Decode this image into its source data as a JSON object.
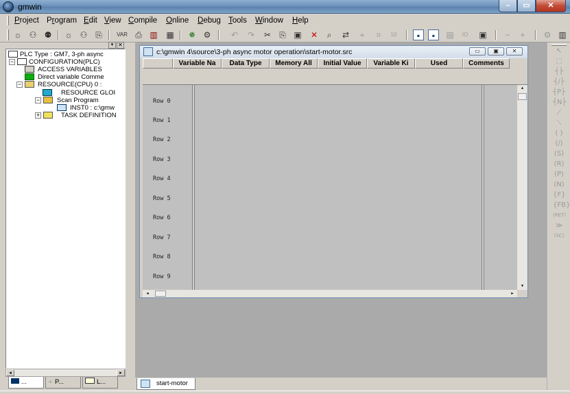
{
  "window": {
    "title": "gmwin"
  },
  "menu": {
    "items": [
      {
        "label": "Project",
        "key": "P"
      },
      {
        "label": "Program",
        "key": "r"
      },
      {
        "label": "Edit",
        "key": "E"
      },
      {
        "label": "View",
        "key": "V"
      },
      {
        "label": "Compile",
        "key": "C"
      },
      {
        "label": "Online",
        "key": "O"
      },
      {
        "label": "Debug",
        "key": "D"
      },
      {
        "label": "Tools",
        "key": "T"
      },
      {
        "label": "Window",
        "key": "W"
      },
      {
        "label": "Help",
        "key": "H"
      }
    ]
  },
  "project_tree": {
    "items": [
      {
        "label": "PLC Type : GM7, 3-ph async",
        "icon": "plc-icon",
        "level": 0
      },
      {
        "label": "CONFIGURATION(PLC)",
        "icon": "configuration-icon",
        "level": 1,
        "expander": "−"
      },
      {
        "label": "ACCESS VARIABLES",
        "icon": "access-variables-icon",
        "level": 2
      },
      {
        "label": "Direct variable Comme",
        "icon": "direct-variable-icon",
        "level": 2
      },
      {
        "label": "RESOURCE(CPU) 0 :",
        "icon": "resource-icon",
        "level": 2,
        "expander": "−"
      },
      {
        "label": "RESOURCE GLOI",
        "icon": "folder-icon",
        "level": 3
      },
      {
        "label": "Scan Program",
        "icon": "open-folder-icon",
        "level": 3,
        "expander": "−"
      },
      {
        "label": "INST0 : c:\\gmw",
        "icon": "instance-icon",
        "level": 4
      },
      {
        "label": "TASK DEFINITION",
        "icon": "task-icon",
        "level": 3,
        "expander": "+"
      }
    ],
    "tabs": [
      {
        "label": "..."
      },
      {
        "label": "P..."
      },
      {
        "label": "L..."
      }
    ]
  },
  "editor": {
    "title": "c:\\gmwin 4\\source\\3-ph async motor operation\\start-motor.src",
    "columns": [
      "Variable Na",
      "Data Type",
      "Memory All",
      "Initial Value",
      "Variable Ki",
      "Used",
      "Comments"
    ],
    "rows": [
      "Row  0",
      "Row  1",
      "Row  2",
      "Row  3",
      "Row  4",
      "Row  5",
      "Row  6",
      "Row  7",
      "Row  8",
      "Row  9"
    ]
  },
  "mdi_tabs": [
    {
      "label": "start-motor"
    }
  ],
  "colors": {
    "titlebar": "#6d93bd",
    "mdi_background": "#aaaaaa",
    "grid_background": "#c0c0c0"
  }
}
